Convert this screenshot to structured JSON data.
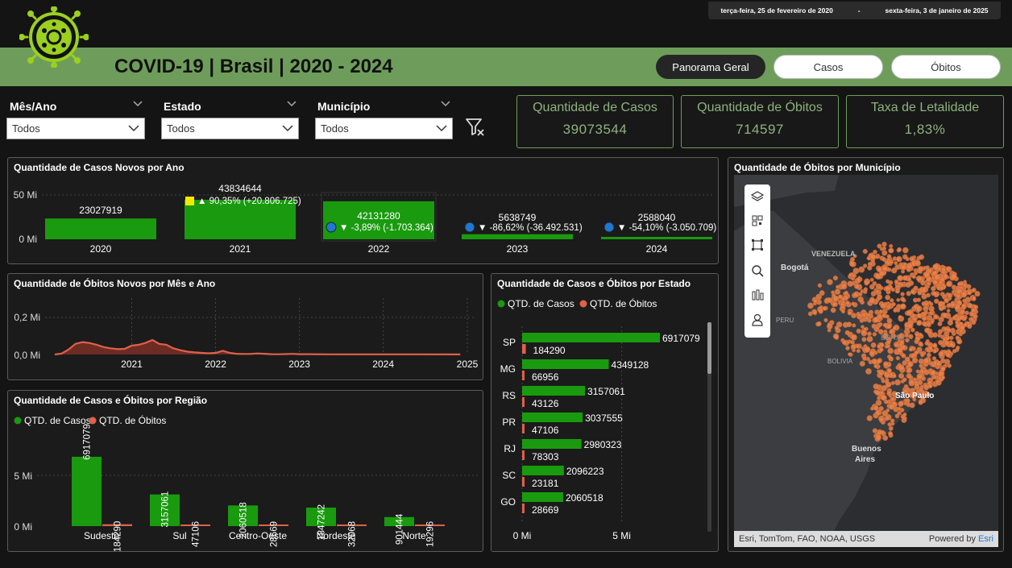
{
  "date_range": {
    "start": "terça-feira, 25 de fevereiro de 2020",
    "separator": "-",
    "end": "sexta-feira, 3 de janeiro de 2025"
  },
  "app_title": "COVID-19 | Brasil | 2020 - 2024",
  "nav": {
    "overview": "Panorama Geral",
    "cases": "Casos",
    "deaths": "Óbitos"
  },
  "filters": {
    "month_year": {
      "label": "Mês/Ano",
      "value": "Todos"
    },
    "state": {
      "label": "Estado",
      "value": "Todos"
    },
    "municipality": {
      "label": "Município",
      "value": "Todos"
    }
  },
  "kpis": {
    "cases": {
      "label": "Quantidade de Casos",
      "value": "39073544"
    },
    "deaths": {
      "label": "Quantidade de Óbitos",
      "value": "714597"
    },
    "lethality": {
      "label": "Taxa de Letalidade",
      "value": "1,83%"
    }
  },
  "panels": {
    "cases_by_year": "Quantidade de Casos Novos por Ano",
    "deaths_by_month": "Quantidade de Óbitos Novos por Mês e Ano",
    "by_region": "Quantidade de Casos e Óbitos por Região",
    "by_state": "Quantidade de Casos e Óbitos por Estado",
    "map": "Quantidade de Óbitos por Município"
  },
  "legend": {
    "cases": "QTD. de Casos",
    "deaths": "QTD. de Óbitos"
  },
  "colors": {
    "accent": "#6e9d5b",
    "cases": "#1a9a0f",
    "deaths": "#e0604a",
    "kpi_text": "#8fb27f",
    "yellow": "#f5e800",
    "blue": "#1f78d1"
  },
  "map": {
    "labels": {
      "venezuela": "VENEZUELA",
      "bogota": "Bogotá",
      "peru": "PERU",
      "bolivia": "BOLIVIA",
      "brasil": "BRASIL",
      "sao_paulo": "São Paulo",
      "buenos_aires_1": "Buenos",
      "buenos_aires_2": "Aires"
    },
    "attribution": "Esri, TomTom, FAO, NOAA, USGS",
    "powered_by": "Powered by ",
    "powered_by_brand": "Esri",
    "toolbar_icons": [
      "layers-icon",
      "qr-icon",
      "select-icon",
      "search-icon",
      "chart-icon",
      "person-icon"
    ]
  },
  "chart_data": [
    {
      "type": "bar",
      "title": "Quantidade de Casos Novos por Ano",
      "categories": [
        "2020",
        "2021",
        "2022",
        "2023",
        "2024"
      ],
      "values": [
        23027919,
        43834644,
        42131280,
        5638749,
        2588040
      ],
      "data_labels": [
        "23027919",
        "43834644",
        "42131280",
        "5638749",
        "2588040"
      ],
      "variation_labels": [
        "",
        "▲ 90,35% (+20.806.725)",
        "▼ -3,89% (-1.703.364)",
        "▼ -86,62% (-36.492.531)",
        "▼ -54,10% (-3.050.709)"
      ],
      "variation_markers": [
        "",
        "yellow",
        "blue",
        "blue",
        "blue"
      ],
      "ytick_labels": [
        "50 Mi",
        "0 Mi"
      ],
      "ylim": [
        0,
        50000000
      ],
      "highlighted": "2022"
    },
    {
      "type": "area",
      "title": "Quantidade de Óbitos Novos por Mês e Ano",
      "x": [
        "2020-02",
        "2020-03",
        "2020-04",
        "2020-05",
        "2020-06",
        "2020-07",
        "2020-08",
        "2020-09",
        "2020-10",
        "2020-11",
        "2020-12",
        "2021-01",
        "2021-02",
        "2021-03",
        "2021-04",
        "2021-05",
        "2021-06",
        "2021-07",
        "2021-08",
        "2021-09",
        "2021-10",
        "2021-11",
        "2021-12",
        "2022-01",
        "2022-02",
        "2022-03",
        "2022-04",
        "2022-05",
        "2022-06",
        "2022-07",
        "2022-08",
        "2022-09",
        "2022-10",
        "2022-11",
        "2022-12",
        "2023-01",
        "2023-06",
        "2023-12",
        "2024-06",
        "2024-12"
      ],
      "values": [
        0,
        5000,
        28000,
        60000,
        70000,
        65000,
        55000,
        42000,
        35000,
        30000,
        32000,
        50000,
        55000,
        65000,
        82000,
        60000,
        55000,
        35000,
        24000,
        16000,
        12000,
        9000,
        7000,
        9000,
        21000,
        10000,
        4000,
        3000,
        3000,
        6000,
        4000,
        2000,
        1500,
        2500,
        3500,
        2000,
        1000,
        800,
        700,
        500
      ],
      "ytick_labels": [
        "0,2 Mi",
        "0,0 Mi"
      ],
      "xtick_labels": [
        "2021",
        "2022",
        "2023",
        "2024",
        "2025"
      ],
      "ylim": [
        0,
        250000
      ]
    },
    {
      "type": "bar",
      "title": "Quantidade de Casos e Óbitos por Região",
      "categories": [
        "Sudeste",
        "Sul",
        "Centro-Oeste",
        "Nordeste",
        "Norte"
      ],
      "series": [
        {
          "name": "QTD. de Casos",
          "values": [
            6917079,
            3157061,
            2060518,
            1847242,
            901444
          ]
        },
        {
          "name": "QTD. de Óbitos",
          "values": [
            184290,
            47106,
            28669,
            32068,
            19296
          ]
        }
      ],
      "ytick_labels": [
        "5 Mi",
        "0 Mi"
      ],
      "ylim": [
        0,
        9000000
      ]
    },
    {
      "type": "bar",
      "title": "Quantidade de Casos e Óbitos por Estado",
      "orientation": "horizontal",
      "categories": [
        "SP",
        "MG",
        "RS",
        "PR",
        "RJ",
        "SC",
        "GO"
      ],
      "series": [
        {
          "name": "QTD. de Casos",
          "values": [
            6917079,
            4349128,
            3157061,
            3037555,
            2980323,
            2096223,
            2060518
          ]
        },
        {
          "name": "QTD. de Óbitos",
          "values": [
            184290,
            66956,
            43126,
            47106,
            78303,
            23181,
            28669
          ]
        }
      ],
      "xtick_labels": [
        "0 Mi",
        "5 Mi"
      ],
      "xlim": [
        0,
        6917079
      ]
    }
  ]
}
